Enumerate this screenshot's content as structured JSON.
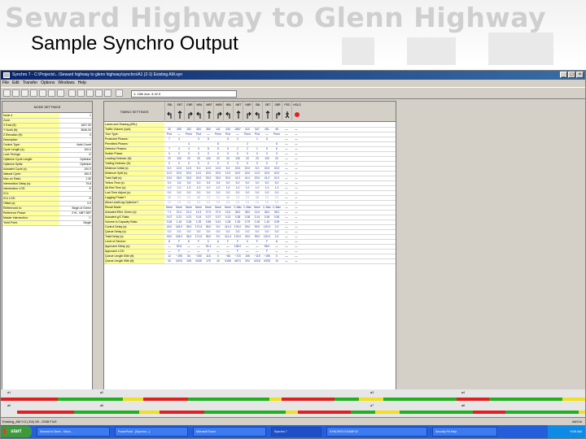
{
  "slide": {
    "watermark_title": "Seward Highway to Glenn Highway",
    "title": "Sample Synchro Output"
  },
  "window": {
    "title": "Synchro 7 - C:\\Projects\\...\\Seward highway to glenn highway\\synchro\\A1 (2-1) Existing AM.syn",
    "menu": [
      "File",
      "Edit",
      "Transfer",
      "Options",
      "Windows",
      "Help"
    ],
    "intersection_select": "1: 15th Ave. & W 5"
  },
  "node_settings": {
    "header": "NODE SETTINGS",
    "rows": [
      {
        "label": "Node #",
        "value": "1"
      },
      {
        "label": "Zone:",
        "value": ""
      },
      {
        "label": "X East (ft):",
        "value": "1607.00"
      },
      {
        "label": "Y North (ft):",
        "value": "3636.00"
      },
      {
        "label": "Z Elevation (ft):",
        "value": "0"
      },
      {
        "label": "Description",
        "value": ""
      },
      {
        "label": "Control Type:",
        "value": "Actd-Coord"
      },
      {
        "label": "Cycle Length (s):",
        "value": "100.0"
      },
      {
        "label": "Lock Timings:",
        "value": "☑"
      },
      {
        "label": "Optimize Cycle Length:",
        "value": "Optimize"
      },
      {
        "label": "Optimize Splits:",
        "value": "Optimize"
      },
      {
        "label": "Actuated Cycle (s):",
        "value": "100.0"
      },
      {
        "label": "Natural Cycle:",
        "value": "150.0"
      },
      {
        "label": "Max v/c Ratio:",
        "value": "1.30"
      },
      {
        "label": "Intersection Delay (s):",
        "value": "79.6"
      },
      {
        "label": "Intersection LOS:",
        "value": "E"
      },
      {
        "label": "ICU:",
        "value": ""
      },
      {
        "label": "ICU LOS:",
        "value": "H"
      },
      {
        "label": "Offset (s):",
        "value": "0.0"
      },
      {
        "label": "Referenced to:",
        "value": "Begin of Green"
      },
      {
        "label": "Reference Phase:",
        "value": "2+6 - NBT SBT"
      },
      {
        "label": "Master Intersection:",
        "value": "☐"
      },
      {
        "label": "Yield Point:",
        "value": "Single"
      }
    ]
  },
  "timing": {
    "header": "TIMING SETTINGS",
    "movements": [
      "EBL",
      "EBT",
      "EBR",
      "WBL",
      "WBT",
      "WBR",
      "NBL",
      "NBT",
      "NBR",
      "SBL",
      "SBT",
      "SBR",
      "PED",
      "HOLD"
    ],
    "rows": [
      {
        "label": "Lanes and Sharing (#RL):",
        "values": [
          "",
          "",
          "",
          "",
          "",
          "",
          "",
          "",
          "",
          "",
          "",
          "",
          "",
          ""
        ]
      },
      {
        "label": "Traffic Volume (vph):",
        "values": [
          "20",
          "495",
          "152",
          "454",
          "350",
          "141",
          "234",
          "1557",
          "410",
          "347",
          "251",
          "49",
          "—",
          "—"
        ]
      },
      {
        "label": "Turn Type:",
        "values": [
          "Prot",
          "—",
          "Perm",
          "Prot",
          "—",
          "Perm",
          "Prot",
          "—",
          "Perm",
          "Prot",
          "—",
          "Perm",
          "—",
          "—"
        ]
      },
      {
        "label": "Protected Phases:",
        "values": [
          "7",
          "4",
          "",
          "3",
          "8",
          "",
          "5",
          "2",
          "",
          "1",
          "6",
          "",
          "—",
          "—"
        ]
      },
      {
        "label": "Permitted Phases:",
        "values": [
          "",
          "",
          "4",
          "",
          "",
          "8",
          "",
          "",
          "2",
          "",
          "",
          "6",
          "—",
          "—"
        ]
      },
      {
        "label": "Detector Phases:",
        "values": [
          "7",
          "4",
          "4",
          "3",
          "8",
          "8",
          "5",
          "2",
          "2",
          "1",
          "6",
          "6",
          "—",
          "—"
        ]
      },
      {
        "label": "Switch Phase:",
        "values": [
          "0",
          "0",
          "0",
          "0",
          "0",
          "0",
          "0",
          "0",
          "0",
          "0",
          "0",
          "0",
          "—",
          "—"
        ]
      },
      {
        "label": "Leading Detector (ft):",
        "values": [
          "20",
          "100",
          "20",
          "20",
          "100",
          "20",
          "20",
          "100",
          "20",
          "20",
          "100",
          "20",
          "—",
          "—"
        ]
      },
      {
        "label": "Trailing Detector (ft):",
        "values": [
          "0",
          "0",
          "0",
          "0",
          "0",
          "0",
          "0",
          "0",
          "0",
          "0",
          "0",
          "0",
          "—",
          "—"
        ]
      },
      {
        "label": "Minimum Initial (s):",
        "values": [
          "5.0",
          "12.0",
          "12.0",
          "5.0",
          "12.0",
          "12.0",
          "5.0",
          "20.0",
          "20.0",
          "5.0",
          "20.0",
          "20.0",
          "—",
          "—"
        ]
      },
      {
        "label": "Minimum Split (s):",
        "values": [
          "12.0",
          "20.0",
          "20.0",
          "12.0",
          "20.0",
          "20.0",
          "12.0",
          "40.0",
          "40.0",
          "12.0",
          "40.0",
          "40.0",
          "—",
          "—"
        ]
      },
      {
        "label": "Total Split (s):",
        "values": [
          "13.0",
          "26.0",
          "26.0",
          "20.0",
          "33.0",
          "33.0",
          "20.0",
          "41.0",
          "41.0",
          "20.0",
          "41.0",
          "41.0",
          "—",
          "—"
        ]
      },
      {
        "label": "Yellow Time (s):",
        "values": [
          "3.0",
          "3.5",
          "3.5",
          "3.0",
          "3.5",
          "3.5",
          "3.0",
          "5.0",
          "5.0",
          "3.0",
          "5.0",
          "5.0",
          "—",
          "—"
        ]
      },
      {
        "label": "All-Red Time (s):",
        "values": [
          "1.0",
          "1.0",
          "1.0",
          "1.0",
          "1.0",
          "1.0",
          "1.0",
          "1.0",
          "1.0",
          "1.0",
          "1.0",
          "1.0",
          "—",
          "—"
        ]
      },
      {
        "label": "Lost Time Adjust (s):",
        "values": [
          "0.0",
          "0.0",
          "0.0",
          "0.0",
          "0.0",
          "0.0",
          "0.0",
          "0.0",
          "0.0",
          "0.0",
          "0.0",
          "0.0",
          "—",
          "—"
        ]
      },
      {
        "label": "Lagging Phase?:",
        "values": [
          "☑",
          "☐",
          "☐",
          "☑",
          "☐",
          "☐",
          "☑",
          "☐",
          "☐",
          "☑",
          "☐",
          "☐",
          "—",
          "—"
        ]
      },
      {
        "label": "Allow Lead/Lag Optimize?:",
        "values": [
          "☐",
          "☐",
          "☐",
          "☐",
          "☐",
          "☐",
          "☐",
          "☐",
          "☐",
          "☐",
          "☐",
          "☐",
          "—",
          "—"
        ]
      },
      {
        "label": "Recall Mode:",
        "values": [
          "None",
          "None",
          "None",
          "None",
          "None",
          "None",
          "None",
          "C-Max",
          "C-Max",
          "None",
          "C-Max",
          "C-Max",
          "—",
          "—"
        ]
      },
      {
        "label": "Actuated Effct. Green (s):",
        "values": [
          "7.2",
          "21.0",
          "21.0",
          "14.3",
          "27.0",
          "27.0",
          "13.0",
          "38.0",
          "38.0",
          "14.0",
          "36.0",
          "36.0",
          "—",
          "—"
        ]
      },
      {
        "label": "Actuated g/C Ratio:",
        "values": [
          "0.07",
          "0.21",
          "0.21",
          "0.14",
          "0.27",
          "0.27",
          "0.13",
          "0.38",
          "0.38",
          "0.14",
          "0.36",
          "0.36",
          "—",
          "—"
        ]
      },
      {
        "label": "Volume to Capacity Ratio:",
        "values": [
          "0.06",
          "1.16",
          "0.35",
          "1.25",
          "0.56",
          "0.41",
          "1.08",
          "1.30",
          "0.79",
          "1.06",
          "1.16",
          "0.09",
          "—",
          "—"
        ]
      },
      {
        "label": "Control Delay (s):",
        "values": [
          "43.0",
          "118.0",
          "36.0",
          "171.6",
          "35.0",
          "9.0",
          "111.0",
          "176.0",
          "25.0",
          "99.0",
          "120.0",
          "2.0",
          "—",
          "—"
        ]
      },
      {
        "label": "Queue Delay (s):",
        "values": [
          "0.0",
          "0.0",
          "0.0",
          "0.0",
          "0.0",
          "0.0",
          "0.0",
          "0.0",
          "0.0",
          "0.0",
          "0.0",
          "0.0",
          "—",
          "—"
        ]
      },
      {
        "label": "Total Delay (s):",
        "values": [
          "43.0",
          "118.0",
          "36.0",
          "171.6",
          "35.0",
          "9.0",
          "111.0",
          "176.0",
          "25.0",
          "99.0",
          "120.0",
          "2.0",
          "—",
          "—"
        ]
      },
      {
        "label": "Level of Service:",
        "values": [
          "D",
          "F",
          "D",
          "F",
          "C",
          "A",
          "F",
          "F",
          "C",
          "F",
          "F",
          "A",
          "—",
          "—"
        ]
      },
      {
        "label": "Approach Delay (s):",
        "values": [
          "—",
          "92.6",
          "—",
          "—",
          "91.4",
          "—",
          "—",
          "138.0",
          "—",
          "—",
          "98.0",
          "—",
          "—",
          "—"
        ]
      },
      {
        "label": "Approach LOS:",
        "values": [
          "—",
          "F",
          "—",
          "—",
          "F",
          "—",
          "—",
          "F",
          "—",
          "—",
          "F",
          "—",
          "—",
          "—"
        ]
      },
      {
        "label": "Queue Length 50th (ft):",
        "values": [
          "12",
          "~195",
          "54",
          "~200",
          "116",
          "0",
          "~86",
          "~723",
          "105",
          "~119",
          "~195",
          "0",
          "—",
          "—"
        ]
      },
      {
        "label": "Queue Length 95th (ft):",
        "values": [
          "34",
          "#315",
          "108",
          "#345",
          "175",
          "40",
          "#166",
          "#874",
          "204",
          "#216",
          "#328",
          "14",
          "—",
          "—"
        ]
      }
    ]
  },
  "strips": {
    "labels": [
      "ø1",
      "ø2",
      "ø3",
      "ø4",
      "ø5",
      "ø6",
      "ø7",
      "ø8"
    ],
    "colors": {
      "green": "#20b020",
      "yellow": "#f0e020",
      "red": "#e02020"
    }
  },
  "statusbar": {
    "left": "Existing_AM 9.3 ( EA) 08 - 2008 FILE",
    "right": "Alt/Ctrl"
  },
  "taskbar": {
    "start": "start",
    "tasks": [
      "Seward to Glenn - Micro...",
      "PowerPoint - [Synchro...]",
      "Microsoft Excel",
      "Synchro 7",
      "SYNCHRO EXAMPLE",
      "Security Pd Help"
    ],
    "clock": "9:05 AM"
  }
}
